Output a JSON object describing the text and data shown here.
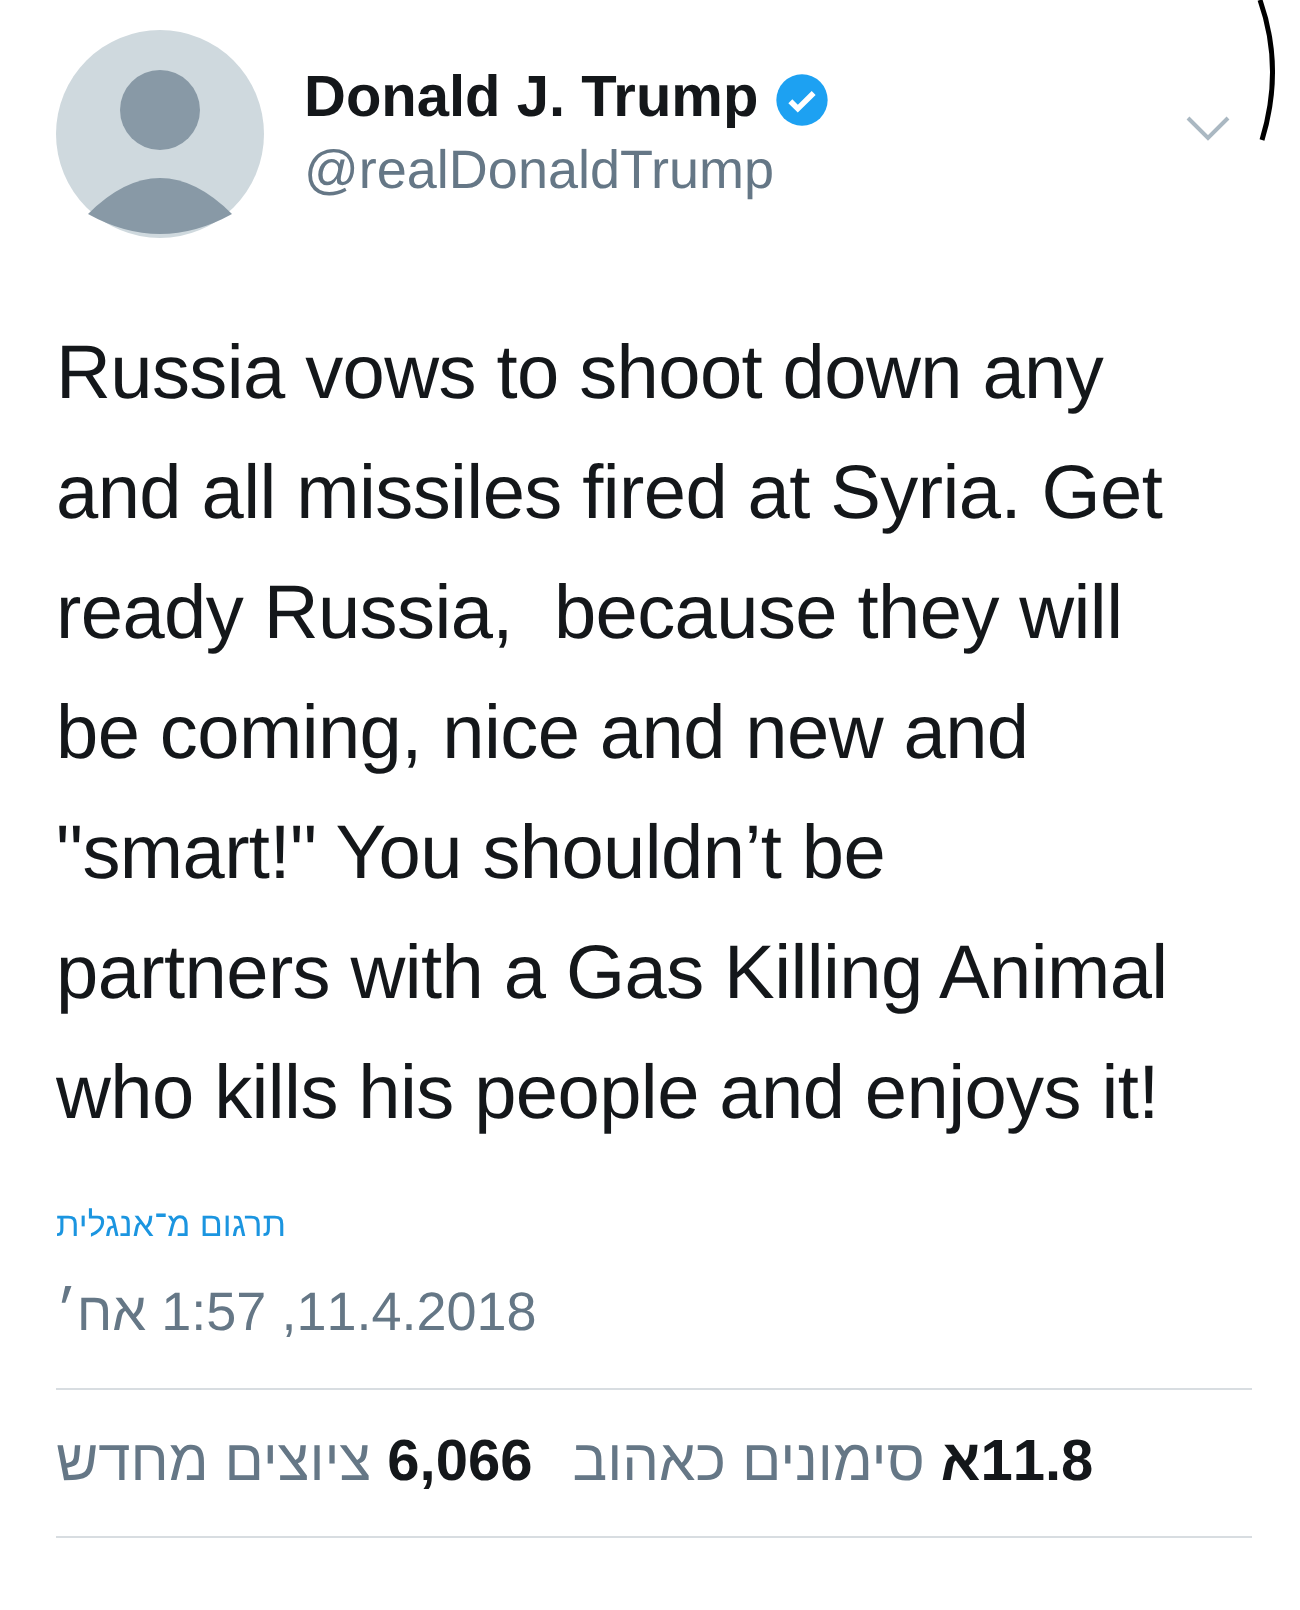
{
  "author": {
    "name": "Donald J. Trump",
    "verified": true,
    "handle": "@realDonaldTrump"
  },
  "tweet": {
    "text": "Russia vows to shoot down any\nand all missiles fired at Syria. Get\nready Russia,  because they will\nbe coming, nice and new and\n\"smart!\" You shouldn’t be\npartners with a Gas Killing Animal\nwho kills his people and enjoys it!",
    "translate_link": "תרגום מ־אנגלית",
    "timestamp": "11.4.2018, 1:57 אח׳"
  },
  "stats": [
    {
      "text": "**11.8א** סימונים כאהוב"
    },
    {
      "text": "**6,066** ציוצים מחדש"
    }
  ]
}
